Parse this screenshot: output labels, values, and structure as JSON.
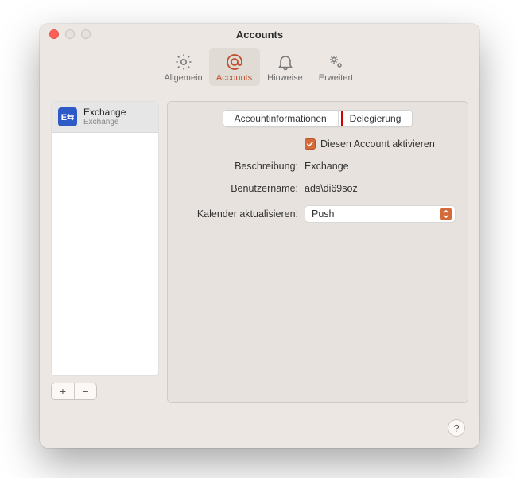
{
  "window": {
    "title": "Accounts"
  },
  "toolbar": {
    "items": [
      {
        "label": "Allgemein"
      },
      {
        "label": "Accounts"
      },
      {
        "label": "Hinweise"
      },
      {
        "label": "Erweitert"
      }
    ]
  },
  "sidebar": {
    "accounts": [
      {
        "name": "Exchange",
        "subtitle": "Exchange"
      }
    ],
    "add": "+",
    "remove": "−"
  },
  "tabs": {
    "info": "Accountinformationen",
    "delegation": "Delegierung"
  },
  "form": {
    "activate_label": "Diesen Account aktivieren",
    "desc_label": "Beschreibung:",
    "desc_value": "Exchange",
    "user_label": "Benutzername:",
    "user_value": "ads\\di69soz",
    "cal_label": "Kalender aktualisieren:",
    "cal_value": "Push"
  },
  "help": "?"
}
